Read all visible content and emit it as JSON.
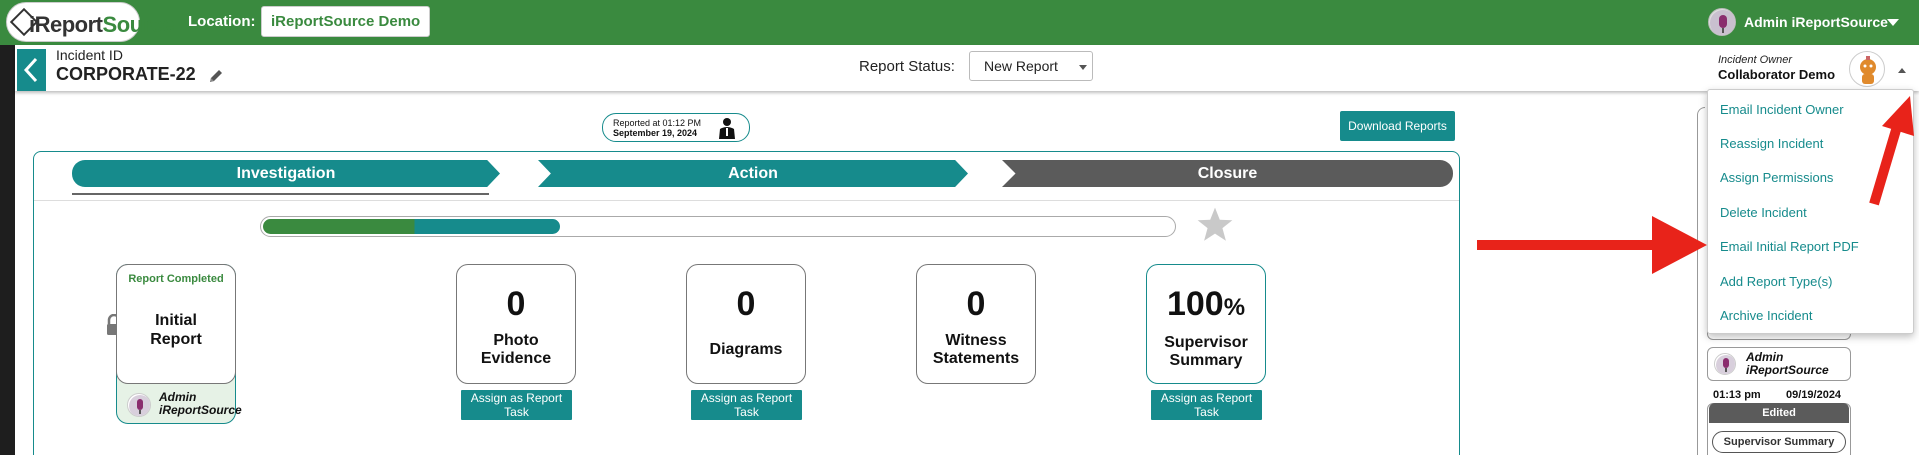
{
  "topbar": {
    "logo_i": "i",
    "logo_report": "Report",
    "logo_source": "Source",
    "location_label": "Location:",
    "location_value": "iReportSource Demo",
    "admin_name": "Admin iReportSource"
  },
  "header": {
    "incident_label": "Incident ID",
    "incident_id": "CORPORATE-22",
    "report_status_label": "Report Status:",
    "report_status_value": "New Report",
    "owner_label": "Incident Owner",
    "owner_name": "Collaborator Demo"
  },
  "reported": {
    "line1": "Reported at 01:12 PM",
    "line2": "September 19, 2024"
  },
  "download_button": "Download Reports",
  "stages": {
    "investigation": "Investigation",
    "action": "Action",
    "closure": "Closure"
  },
  "progress": {
    "percent": 27
  },
  "initial_report": {
    "status": "Report Completed",
    "title_line1": "Initial",
    "title_line2": "Report",
    "user_line1": "Admin",
    "user_line2": "iReportSource"
  },
  "metrics": [
    {
      "value": "0",
      "label_line1": "Photo",
      "label_line2": "Evidence",
      "assign_line1": "Assign as Report",
      "assign_line2": "Task"
    },
    {
      "value": "0",
      "label_line1": "Diagrams",
      "label_line2": "",
      "assign_line1": "Assign as Report",
      "assign_line2": "Task"
    },
    {
      "value": "0",
      "label_line1": "Witness",
      "label_line2": "Statements"
    },
    {
      "value": "100",
      "unit": "%",
      "label_line1": "Supervisor",
      "label_line2": "Summary",
      "assign_line1": "Assign as Report",
      "assign_line2": "Task"
    }
  ],
  "menu": [
    "Email Incident Owner",
    "Reassign Incident",
    "Assign Permissions",
    "Delete Incident",
    "Email Initial Report PDF",
    "Add Report Type(s)",
    "Archive Incident"
  ],
  "right_panel": {
    "user_line1": "Admin",
    "user_line2": "iReportSource",
    "time": "01:13 pm",
    "date": "09/19/2024",
    "edited": "Edited",
    "supervisor_summary": "Supervisor Summary"
  },
  "colors": {
    "brand_green": "#3a8a3f",
    "teal": "#168b8c",
    "closure_gray": "#5b5b5b",
    "annotation_red": "#e8231a"
  }
}
